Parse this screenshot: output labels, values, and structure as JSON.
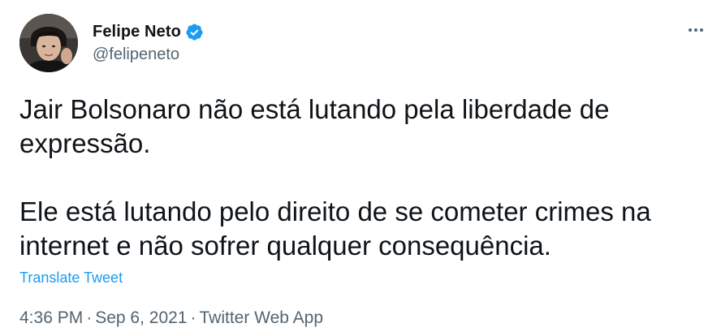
{
  "author": {
    "display_name": "Felipe Neto",
    "handle": "@felipeneto",
    "verified": true,
    "verified_color": "#1d9bf0"
  },
  "tweet": {
    "paragraphs": [
      "Jair Bolsonaro não está lutando pela liberdade de expressão.",
      "Ele está lutando pelo direito de se cometer crimes na internet e não sofrer qualquer consequência."
    ],
    "translate_label": "Translate Tweet"
  },
  "meta": {
    "time": "4:36 PM",
    "date": "Sep 6, 2021",
    "source": "Twitter Web App",
    "separator": "·"
  },
  "icons": {
    "avatar": "avatar-photo",
    "verified": "verified-badge-icon",
    "more": "more-options-icon"
  },
  "colors": {
    "text_primary": "#0f1419",
    "text_secondary": "#536471",
    "link": "#1d9bf0"
  }
}
